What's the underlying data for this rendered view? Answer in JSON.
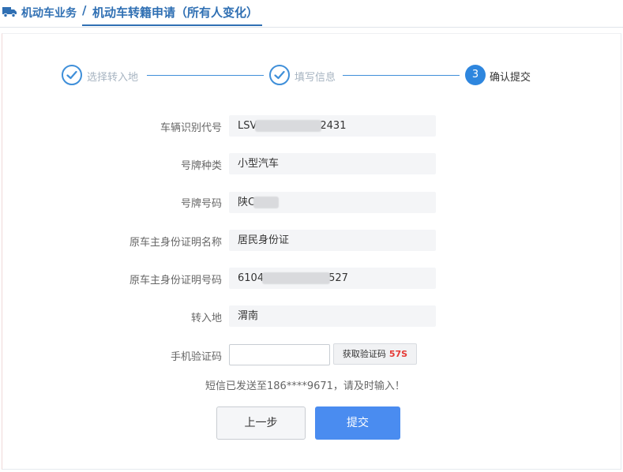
{
  "breadcrumb": {
    "root": "机动车业务",
    "separator": "/",
    "current": "机动车转籍申请（所有人变化）"
  },
  "steps": [
    {
      "label": "选择转入地",
      "state": "done"
    },
    {
      "label": "填写信息",
      "state": "done"
    },
    {
      "number": "3",
      "label": "确认提交",
      "state": "active"
    }
  ],
  "form": {
    "vin": {
      "label": "车辆识别代号",
      "prefix": "LSV",
      "suffix": "2431"
    },
    "plate_type": {
      "label": "号牌种类",
      "value": "小型汽车"
    },
    "plate_number": {
      "label": "号牌号码",
      "prefix": "陕C"
    },
    "id_type": {
      "label": "原车主身份证明名称",
      "value": "居民身份证"
    },
    "id_number": {
      "label": "原车主身份证明号码",
      "prefix": "6104",
      "suffix": "527"
    },
    "destination": {
      "label": "转入地",
      "value": "渭南"
    },
    "sms_code": {
      "label": "手机验证码",
      "value": "",
      "button_label": "获取验证码",
      "countdown": "57S"
    }
  },
  "hint": "短信已发送至186****9671，请及时输入！",
  "buttons": {
    "prev": "上一步",
    "submit": "提交"
  },
  "colors": {
    "brand": "#2f6fb3",
    "step_accent": "#2e86de",
    "submit": "#4a8cf0",
    "countdown": "#e53935"
  }
}
